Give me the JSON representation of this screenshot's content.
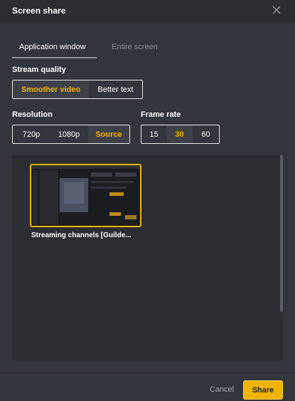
{
  "window": {
    "title": "Screen share",
    "close_icon": "close-icon"
  },
  "tabs": [
    {
      "label": "Application window",
      "active": true
    },
    {
      "label": "Entire screen",
      "active": false
    }
  ],
  "stream_quality": {
    "label": "Stream quality",
    "options": [
      "Smoother video",
      "Better text"
    ],
    "selected": "Smoother video"
  },
  "resolution": {
    "label": "Resolution",
    "options": [
      "720p",
      "1080p",
      "Source"
    ],
    "selected": "Source"
  },
  "frame_rate": {
    "label": "Frame rate",
    "options": [
      "15",
      "30",
      "60"
    ],
    "selected": "30"
  },
  "windows": [
    {
      "caption": "Streaming channels [Guilde..."
    }
  ],
  "footer": {
    "cancel_label": "Cancel",
    "share_label": "Share"
  },
  "colors": {
    "accent": "#f0b400",
    "background": "#33353c",
    "titlebar": "#2b2d33"
  }
}
